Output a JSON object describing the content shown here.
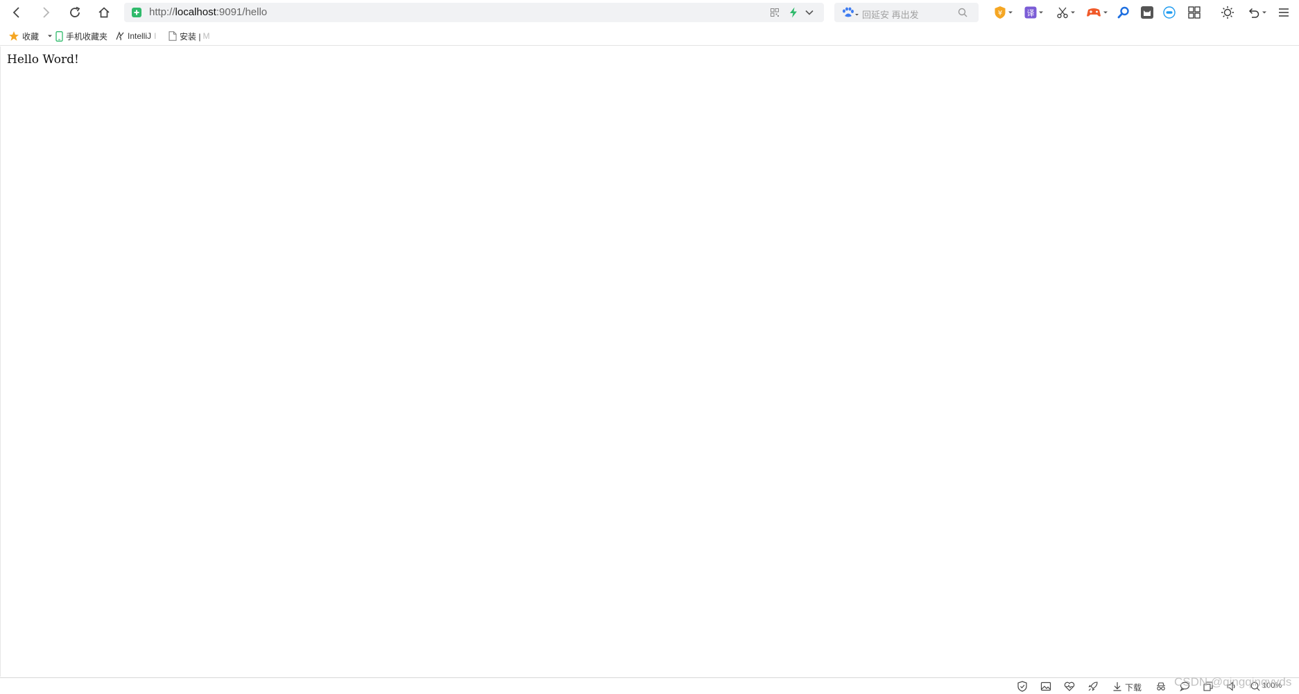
{
  "toolbar": {
    "back_icon": "back-arrow-icon",
    "forward_icon": "forward-arrow-icon",
    "reload_icon": "reload-icon",
    "home_icon": "home-icon",
    "address": {
      "scheme": "http://",
      "host": "localhost",
      "rest": ":9091/hello",
      "secure_badge_color": "#2fba6b"
    },
    "search": {
      "engine_icon": "baidu-paw-icon",
      "placeholder": "回延安 再出发"
    },
    "extensions": [
      "shield-coin-icon",
      "translate-icon",
      "scissors-icon",
      "game-controller-icon",
      "magnifier-icon",
      "cat-icon",
      "emoji-icon",
      "grid-icon",
      "brightness-icon",
      "undo-icon",
      "menu-icon"
    ]
  },
  "bookmarks": {
    "favorites": "收藏",
    "mobile": "手机收藏夹",
    "intellij": "IntelliJ",
    "intellij_tail": "I",
    "install": "安装 |",
    "install_tail": "M"
  },
  "page": {
    "text": "Hello Word!"
  },
  "statusbar": {
    "download": "下载",
    "zoom": "100%"
  },
  "watermark": "CSDN @qingqingyyds",
  "colors": {
    "accent": "#1e9bf0",
    "star": "#f5a623",
    "bolt": "#2fba6b"
  }
}
